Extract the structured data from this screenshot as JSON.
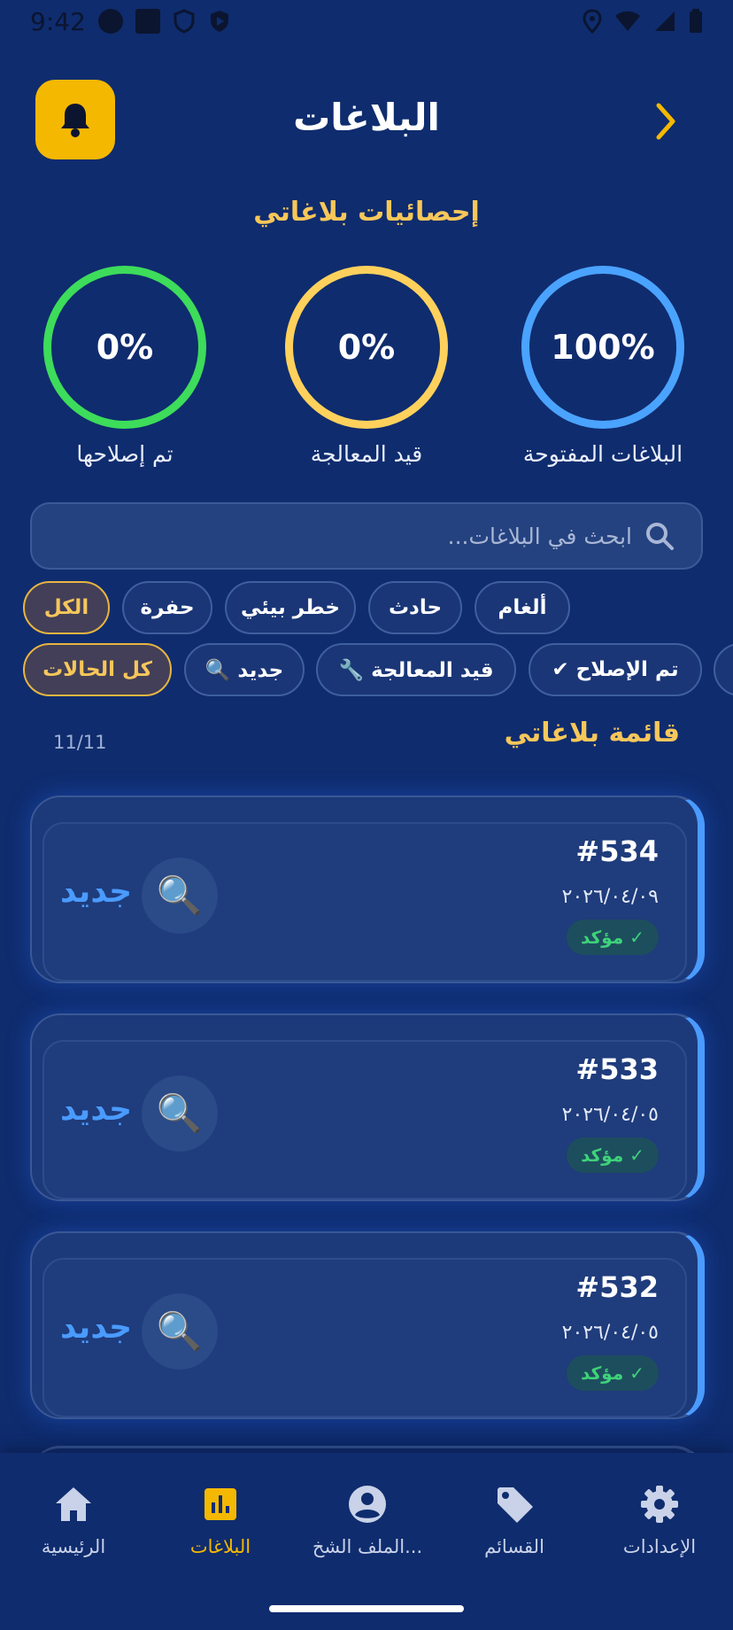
{
  "status_bar": {
    "time": "9:42"
  },
  "header": {
    "title": "البلاغات"
  },
  "stats": {
    "heading": "إحصائيات بلاغاتي",
    "items": [
      {
        "value": "100%",
        "label": "البلاغات المفتوحة",
        "color": "#4aa3ff"
      },
      {
        "value": "0%",
        "label": "قيد المعالجة",
        "color": "#ffd15c"
      },
      {
        "value": "0%",
        "label": "تم إصلاحها",
        "color": "#3ddc5a"
      }
    ]
  },
  "search": {
    "placeholder": "ابحث في البلاغات..."
  },
  "category_filters": [
    "ألغام",
    "حادث",
    "خطر بيئي",
    "حفرة",
    "الكل"
  ],
  "status_filters": [
    "تم الإصلاح ✔",
    "قيد المعالجة 🔧",
    "جديد 🔍",
    "كل الحالات"
  ],
  "list": {
    "heading": "قائمة بلاغاتي",
    "count": "11/11",
    "reports": [
      {
        "number": "#534",
        "date": "٢٠٢٦/٠٤/٠٩",
        "badge": "✓ مؤكد",
        "status": "جديد",
        "icon": "🔍"
      },
      {
        "number": "#533",
        "date": "٢٠٢٦/٠٤/٠٥",
        "badge": "✓ مؤكد",
        "status": "جديد",
        "icon": "🔍"
      },
      {
        "number": "#532",
        "date": "٢٠٢٦/٠٤/٠٥",
        "badge": "✓ مؤكد",
        "status": "جديد",
        "icon": "🔍"
      }
    ]
  },
  "bottom_nav": [
    {
      "label": "الرئيسية",
      "icon": "home-icon"
    },
    {
      "label": "البلاغات",
      "icon": "reports-icon",
      "active": true
    },
    {
      "label": "الملف الشخ...",
      "icon": "profile-icon"
    },
    {
      "label": "القسائم",
      "icon": "tag-icon"
    },
    {
      "label": "الإعدادات",
      "icon": "gear-icon"
    }
  ],
  "colors": {
    "background": "#0f2c6e",
    "accent": "#f5b800",
    "heading": "#f7c75a",
    "status_new": "#4a9bff"
  }
}
